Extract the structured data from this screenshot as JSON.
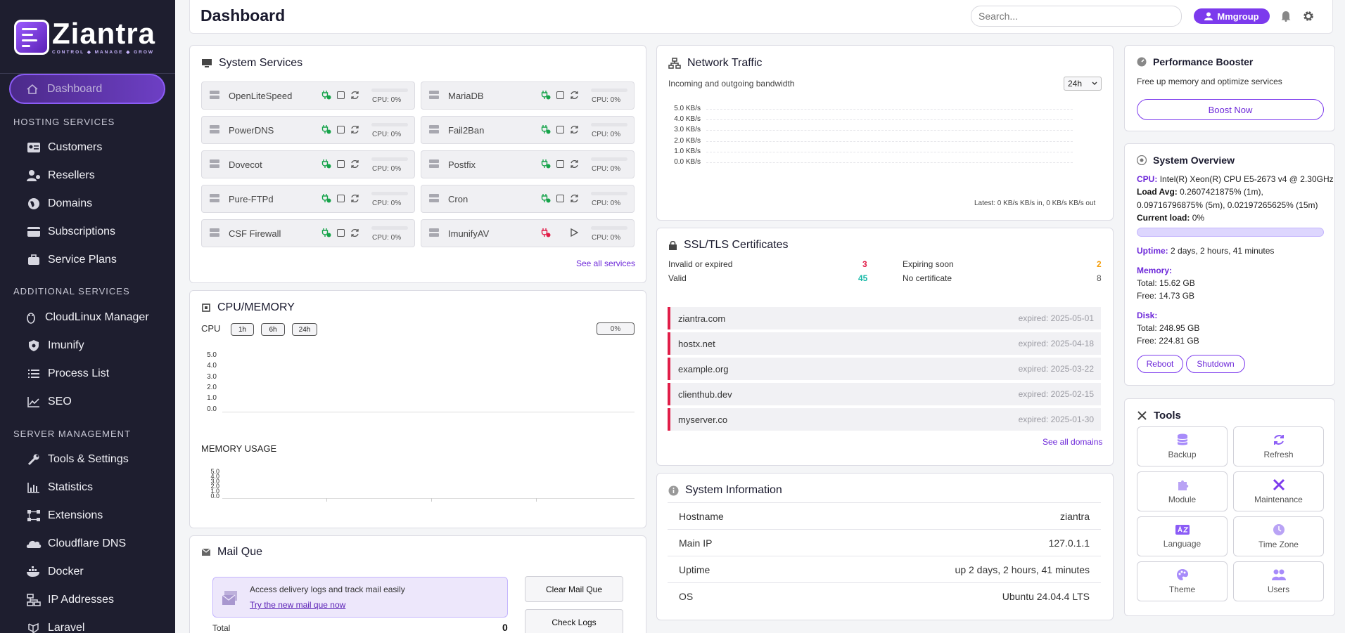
{
  "brand": {
    "name": "Ziantra",
    "tagline": "CONTROL ◆ MANAGE ◆ GROW"
  },
  "sidebar": {
    "active": "Dashboard",
    "sections": [
      {
        "title": "HOSTING SERVICES",
        "items": [
          {
            "label": "Customers",
            "icon": "customers-icon"
          },
          {
            "label": "Resellers",
            "icon": "resellers-icon"
          },
          {
            "label": "Domains",
            "icon": "globe-icon"
          },
          {
            "label": "Subscriptions",
            "icon": "card-icon"
          },
          {
            "label": "Service Plans",
            "icon": "briefcase-icon"
          }
        ]
      },
      {
        "title": "ADDITIONAL SERVICES",
        "items": [
          {
            "label": "CloudLinux Manager",
            "icon": "linux-icon"
          },
          {
            "label": "Imunify",
            "icon": "shield-icon"
          },
          {
            "label": "Process List",
            "icon": "list-icon"
          },
          {
            "label": "SEO",
            "icon": "chart-line-icon"
          }
        ]
      },
      {
        "title": "SERVER MANAGEMENT",
        "items": [
          {
            "label": "Tools & Settings",
            "icon": "wrench-icon"
          },
          {
            "label": "Statistics",
            "icon": "bar-chart-icon"
          },
          {
            "label": "Extensions",
            "icon": "extensions-icon"
          },
          {
            "label": "Cloudflare DNS",
            "icon": "cloud-icon"
          },
          {
            "label": "Docker",
            "icon": "docker-icon"
          },
          {
            "label": "IP Addresses",
            "icon": "network-icon"
          },
          {
            "label": "Laravel",
            "icon": "laravel-icon"
          }
        ]
      }
    ]
  },
  "header": {
    "title": "Dashboard",
    "search_placeholder": "Search...",
    "user": "Mmgroup"
  },
  "services": {
    "title": "System Services",
    "items": [
      {
        "name": "OpenLiteSpeed",
        "status": "running",
        "cpu": "CPU: 0%"
      },
      {
        "name": "MariaDB",
        "status": "running",
        "cpu": "CPU: 0%"
      },
      {
        "name": "PowerDNS",
        "status": "running",
        "cpu": "CPU: 0%"
      },
      {
        "name": "Fail2Ban",
        "status": "running",
        "cpu": "CPU: 0%"
      },
      {
        "name": "Dovecot",
        "status": "running",
        "cpu": "CPU: 0%"
      },
      {
        "name": "Postfix",
        "status": "running",
        "cpu": "CPU: 0%"
      },
      {
        "name": "Pure-FTPd",
        "status": "running",
        "cpu": "CPU: 0%"
      },
      {
        "name": "Cron",
        "status": "running",
        "cpu": "CPU: 0%"
      },
      {
        "name": "CSF Firewall",
        "status": "running",
        "cpu": "CPU: 0%"
      },
      {
        "name": "ImunifyAV",
        "status": "stopped",
        "cpu": "CPU: 0%"
      }
    ],
    "see_all": "See all services"
  },
  "cpu_memory": {
    "title": "CPU/MEMORY",
    "cpu_label": "CPU",
    "ranges": [
      "1h",
      "6h",
      "24h"
    ],
    "cpu_value": "0%",
    "y_ticks": [
      "5.0",
      "4.0",
      "3.0",
      "2.0",
      "1.0",
      "0.0"
    ],
    "memory_title": "MEMORY USAGE",
    "mem_ticks": [
      "5.0",
      "4.0",
      "3.0",
      "2.0",
      "1.0",
      "0.0"
    ]
  },
  "mail": {
    "title": "Mail Que",
    "info": "Access delivery logs and track mail easily",
    "link": "Try the new mail que now",
    "clear_btn": "Clear Mail Que",
    "logs_btn": "Check Logs",
    "total_label": "Total",
    "total_value": "0"
  },
  "network": {
    "title": "Network Traffic",
    "subtitle": "Incoming and outgoing bandwidth",
    "range": "24h",
    "y_ticks": [
      "5.0 KB/s",
      "4.0 KB/s",
      "3.0 KB/s",
      "2.0 KB/s",
      "1.0 KB/s",
      "0.0 KB/s"
    ],
    "latest": "Latest: 0 KB/s KB/s in, 0 KB/s KB/s out"
  },
  "ssl": {
    "title": "SSL/TLS Certificates",
    "invalid_label": "Invalid or expired",
    "invalid": "3",
    "expiring_label": "Expiring soon",
    "expiring": "2",
    "valid_label": "Valid",
    "valid": "45",
    "nocert_label": "No certificate",
    "nocert": "8",
    "domains": [
      {
        "domain": "ziantra.com",
        "status": "expired: 2025-05-01"
      },
      {
        "domain": "hostx.net",
        "status": "expired: 2025-04-18"
      },
      {
        "domain": "example.org",
        "status": "expired: 2025-03-22"
      },
      {
        "domain": "clienthub.dev",
        "status": "expired: 2025-02-15"
      },
      {
        "domain": "myserver.co",
        "status": "expired: 2025-01-30"
      }
    ],
    "see_all": "See all domains"
  },
  "sysinfo": {
    "title": "System Information",
    "rows": [
      {
        "label": "Hostname",
        "value": "ziantra"
      },
      {
        "label": "Main IP",
        "value": "127.0.1.1"
      },
      {
        "label": "Uptime",
        "value": "up 2 days, 2 hours, 41 minutes"
      },
      {
        "label": "OS",
        "value": "Ubuntu 24.04.4 LTS"
      }
    ]
  },
  "booster": {
    "title": "Performance Booster",
    "desc": "Free up memory and optimize services",
    "button": "Boost Now"
  },
  "overview": {
    "title": "System Overview",
    "cpu_label": "CPU:",
    "cpu": "Intel(R) Xeon(R) CPU E5-2673 v4 @ 2.30GHz",
    "load_label": "Load Avg:",
    "load_1": "0.2607421875% (1m),",
    "load_2": "0.09716796875% (5m), 0.02197265625% (15m)",
    "current_label": "Current load:",
    "current": "0%",
    "current_fraction": 0.0,
    "uptime_label": "Uptime:",
    "uptime": "2 days, 2 hours, 41 minutes",
    "memory_label": "Memory:",
    "mem_total": "Total: 15.62 GB",
    "mem_free": "Free: 14.73 GB",
    "disk_label": "Disk:",
    "disk_total": "Total: 248.95 GB",
    "disk_free": "Free: 224.81 GB",
    "reboot": "Reboot",
    "shutdown": "Shutdown"
  },
  "tools": {
    "title": "Tools",
    "items": [
      {
        "label": "Backup",
        "icon": "database-icon"
      },
      {
        "label": "Refresh",
        "icon": "refresh-icon"
      },
      {
        "label": "Module",
        "icon": "puzzle-icon"
      },
      {
        "label": "Maintenance",
        "icon": "tools-icon"
      },
      {
        "label": "Language",
        "icon": "language-icon"
      },
      {
        "label": "Time Zone",
        "icon": "clock-icon"
      },
      {
        "label": "Theme",
        "icon": "palette-icon"
      },
      {
        "label": "Users",
        "icon": "users-icon"
      }
    ]
  },
  "colors": {
    "accent": "#7c3aed",
    "sidebar_bg": "#1e1e2f",
    "danger": "#e11d48",
    "success": "#16a34a",
    "warning": "#f59e0b",
    "teal": "#14b8a6"
  }
}
